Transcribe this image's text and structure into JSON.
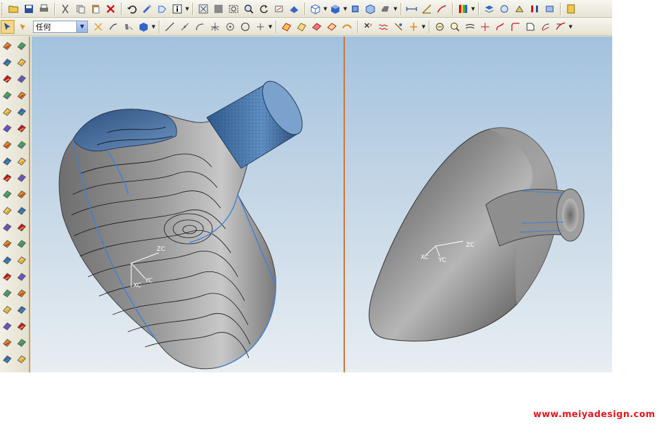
{
  "toolbar": {
    "selection_filter": {
      "selected": "任何"
    }
  },
  "views": {
    "left": {
      "axes": [
        "XC",
        "YC",
        "ZC"
      ]
    },
    "right": {
      "axes": [
        "XC",
        "YC",
        "ZC"
      ]
    }
  },
  "watermark": {
    "text": "www.meiyadesign.com"
  },
  "colors": {
    "background_top": "#a3c2de",
    "background_bottom": "#e8eef2",
    "surface_gray": "#8a8a8a",
    "surface_blue": "#3f6e9f",
    "watermark": "#e8141c",
    "divider": "#c8763a"
  }
}
